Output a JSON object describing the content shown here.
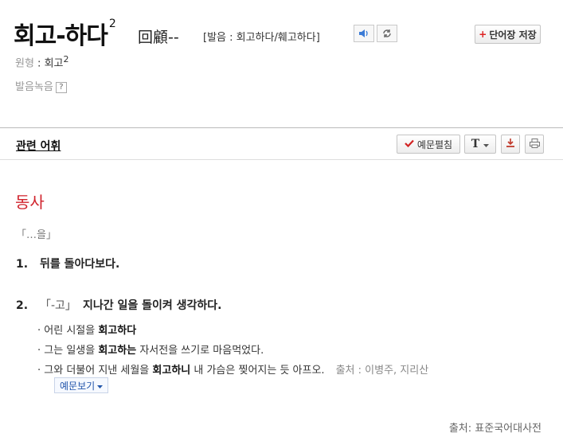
{
  "header": {
    "headword": "회고-하다",
    "homograph": "2",
    "hanja": "回顧--",
    "pronunciation": "[발음 : 회고하다/훼고하다]",
    "save_label": "단어장 저장",
    "save_plus": "+"
  },
  "meta": {
    "form_label": "원형",
    "form_sep": " : ",
    "form_value": "회고",
    "form_sup": "2",
    "recording_label": "발음녹음",
    "help_glyph": "?"
  },
  "toolbar": {
    "related_label": "관련 어휘",
    "example_toggle_label": "예문펼침",
    "font_label": "T"
  },
  "entry": {
    "pos": "동사",
    "pattern": "「…을」",
    "senses": [
      {
        "num": "1.",
        "tag": "",
        "definition": "뒤를 돌아다보다."
      },
      {
        "num": "2.",
        "tag": "「-고」",
        "definition": "지나간 일을 돌이켜 생각하다."
      }
    ],
    "examples": [
      {
        "pre": "어린 시절을 ",
        "hl": "회고하다",
        "post": "",
        "source": ""
      },
      {
        "pre": "그는 일생을 ",
        "hl": "회고하는",
        "post": " 자서전을 쓰기로 마음먹었다.",
        "source": ""
      },
      {
        "pre": "그와 더불어 지낸 세월을 ",
        "hl": "회고하니",
        "post": " 내 가슴은 찢어지는 듯 아프오.",
        "source": "출처 : 이병주, 지리산"
      }
    ],
    "more_examples_label": "예문보기"
  },
  "footer": {
    "source": "출처: 표준국어대사전"
  },
  "colors": {
    "pos": "#d0222b",
    "check": "#d22222",
    "link": "#2255aa"
  }
}
